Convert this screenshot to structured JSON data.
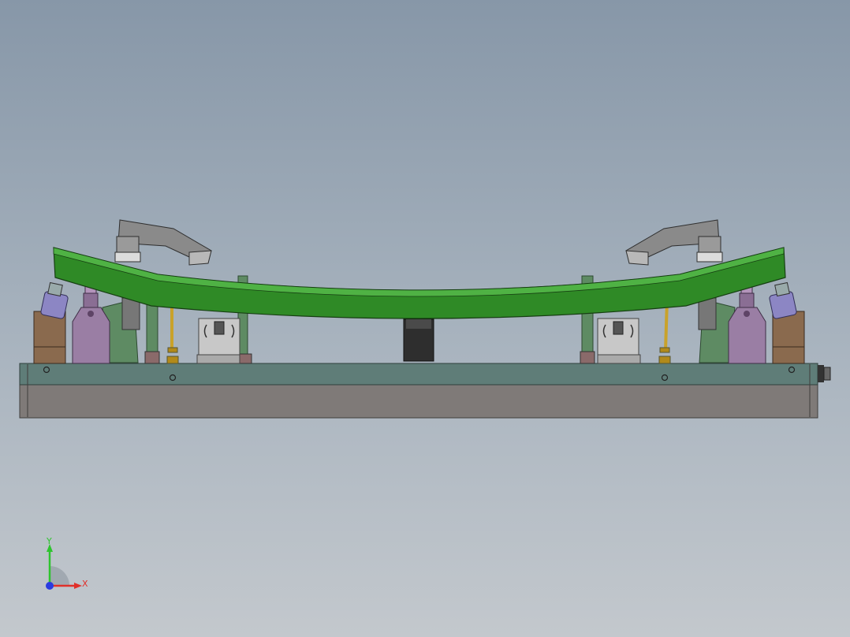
{
  "triad": {
    "x_label": "X",
    "y_label": "Y",
    "x_color": "#e0302a",
    "y_color": "#2ec42e",
    "z_color": "#2a3ce0"
  },
  "colors": {
    "background_top": "#8797a8",
    "background_bottom": "#c3c8cd",
    "fixture_green": "#2f8a26",
    "base_plate": "#5f7d78",
    "base_block": "#7f7a78",
    "cylinder_purple": "#9a7ea4",
    "clamp_grey": "#8a8a8a",
    "block_brown": "#8a6a4e",
    "tube_brass": "#c9a22a"
  }
}
